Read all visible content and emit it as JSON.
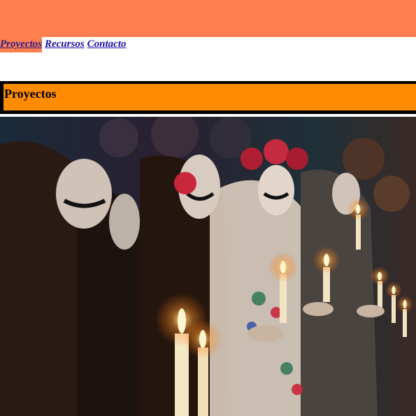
{
  "nav": {
    "items": [
      {
        "label": "Proyectos",
        "active": true
      },
      {
        "label": "Recursos",
        "active": false
      },
      {
        "label": "Contacto",
        "active": false
      }
    ]
  },
  "section": {
    "title": "Proyectos"
  },
  "colors": {
    "banner": "#ff7f50",
    "header_bg": "#ff8c00",
    "link": "#1a0dab"
  }
}
